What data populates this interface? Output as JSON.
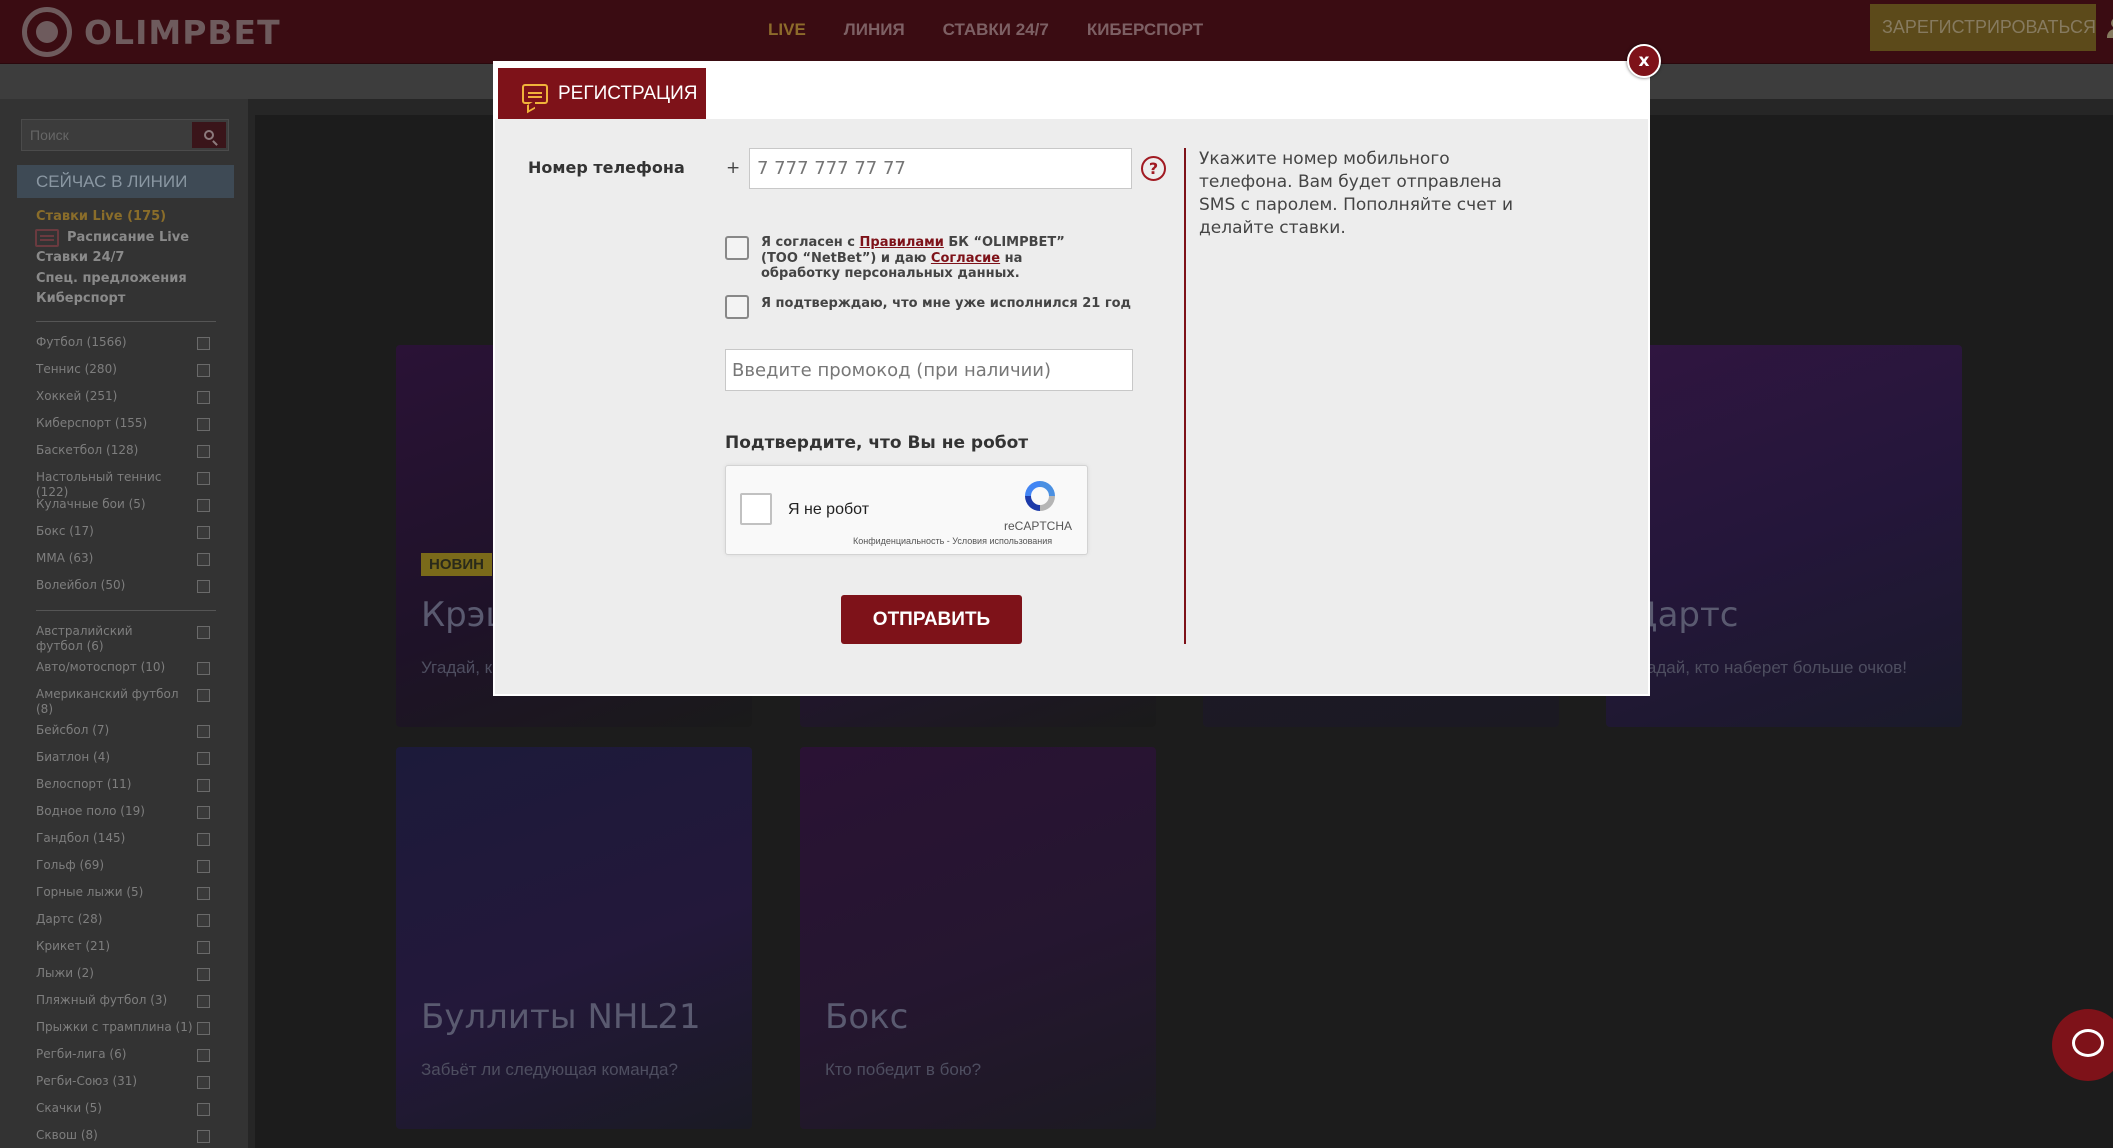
{
  "header": {
    "logo_text": "OLIMPBET",
    "nav": [
      "LIVE",
      "ЛИНИЯ",
      "СТАВКИ 24/7",
      "КИБЕРСПОРТ"
    ],
    "register_label": "ЗАРЕГИСТРИРОВАТЬСЯ"
  },
  "sidebar": {
    "search_placeholder": "Поиск",
    "section_title": "СЕЙЧАС В ЛИНИИ",
    "links": {
      "live": "Ставки Live (175)",
      "schedule": "Расписание Live",
      "bets247": "Ставки 24/7",
      "special": "Спец. предложения",
      "esports": "Киберспорт"
    },
    "sports_top": [
      "Футбол (1566)",
      "Теннис (280)",
      "Хоккей (251)",
      "Киберспорт (155)",
      "Баскетбол (128)",
      "Настольный теннис (122)",
      "Кулачные бои (5)",
      "Бокс (17)",
      "MMA (63)",
      "Волейбол (50)"
    ],
    "sports_more": [
      "Австралийский футбол (6)",
      "Авто/мотоспорт (10)",
      "Американский футбол (8)",
      "Бейсбол (7)",
      "Биатлон (4)",
      "Велоспорт (11)",
      "Водное поло (19)",
      "Гандбол (145)",
      "Гольф (69)",
      "Горные лыжи (5)",
      "Дартс (28)",
      "Крикет (21)",
      "Лыжи (2)",
      "Пляжный футбол (3)",
      "Прыжки с трамплина (1)",
      "Регби-лига (6)",
      "Регби-Союз (31)",
      "Скачки (5)",
      "Сквош (8)"
    ]
  },
  "cards": {
    "crash": {
      "badge": "НОВИН",
      "title": "Крэш",
      "sub": "Угадай, к"
    },
    "darts": {
      "title": "Дартс",
      "sub": "Угадай, кто наберет больше очков!"
    },
    "nhl": {
      "title": "Буллиты NHL21",
      "sub": "Забьёт ли следующая команда?"
    },
    "boxing": {
      "title": "Бокс",
      "sub": "Кто победит в бою?"
    }
  },
  "modal": {
    "tab_label": "РЕГИСТРАЦИЯ",
    "close_label": "x",
    "phone_label": "Номер телефона",
    "plus": "+",
    "phone_placeholder": "7 777 777 77 77",
    "help_label": "?",
    "hint": "Укажите номер мобильного телефона. Вам будет отправлена SMS с паролем. Пополняйте счет и делайте ставки.",
    "agree": {
      "part1": "Я согласен с ",
      "rules_link": "Правилами",
      "part2": " БК “OLIMPBET” (ТОО “NetBet”) и даю ",
      "consent_link": "Согласие",
      "part3": " на обработку персональных данных."
    },
    "age_confirm": "Я подтверждаю, что мне уже исполнился 21 год",
    "promo_placeholder": "Введите промокод (при наличии)",
    "robot_title": "Подтвердите, что Вы не робот",
    "recaptcha": {
      "label": "Я не робот",
      "brand": "reCAPTCHA",
      "links": "Конфиденциальность - Условия использования"
    },
    "submit_label": "ОТПРАВИТЬ"
  },
  "colors": {
    "brand": "#7e1219",
    "accent_gold": "#f0b33a"
  }
}
